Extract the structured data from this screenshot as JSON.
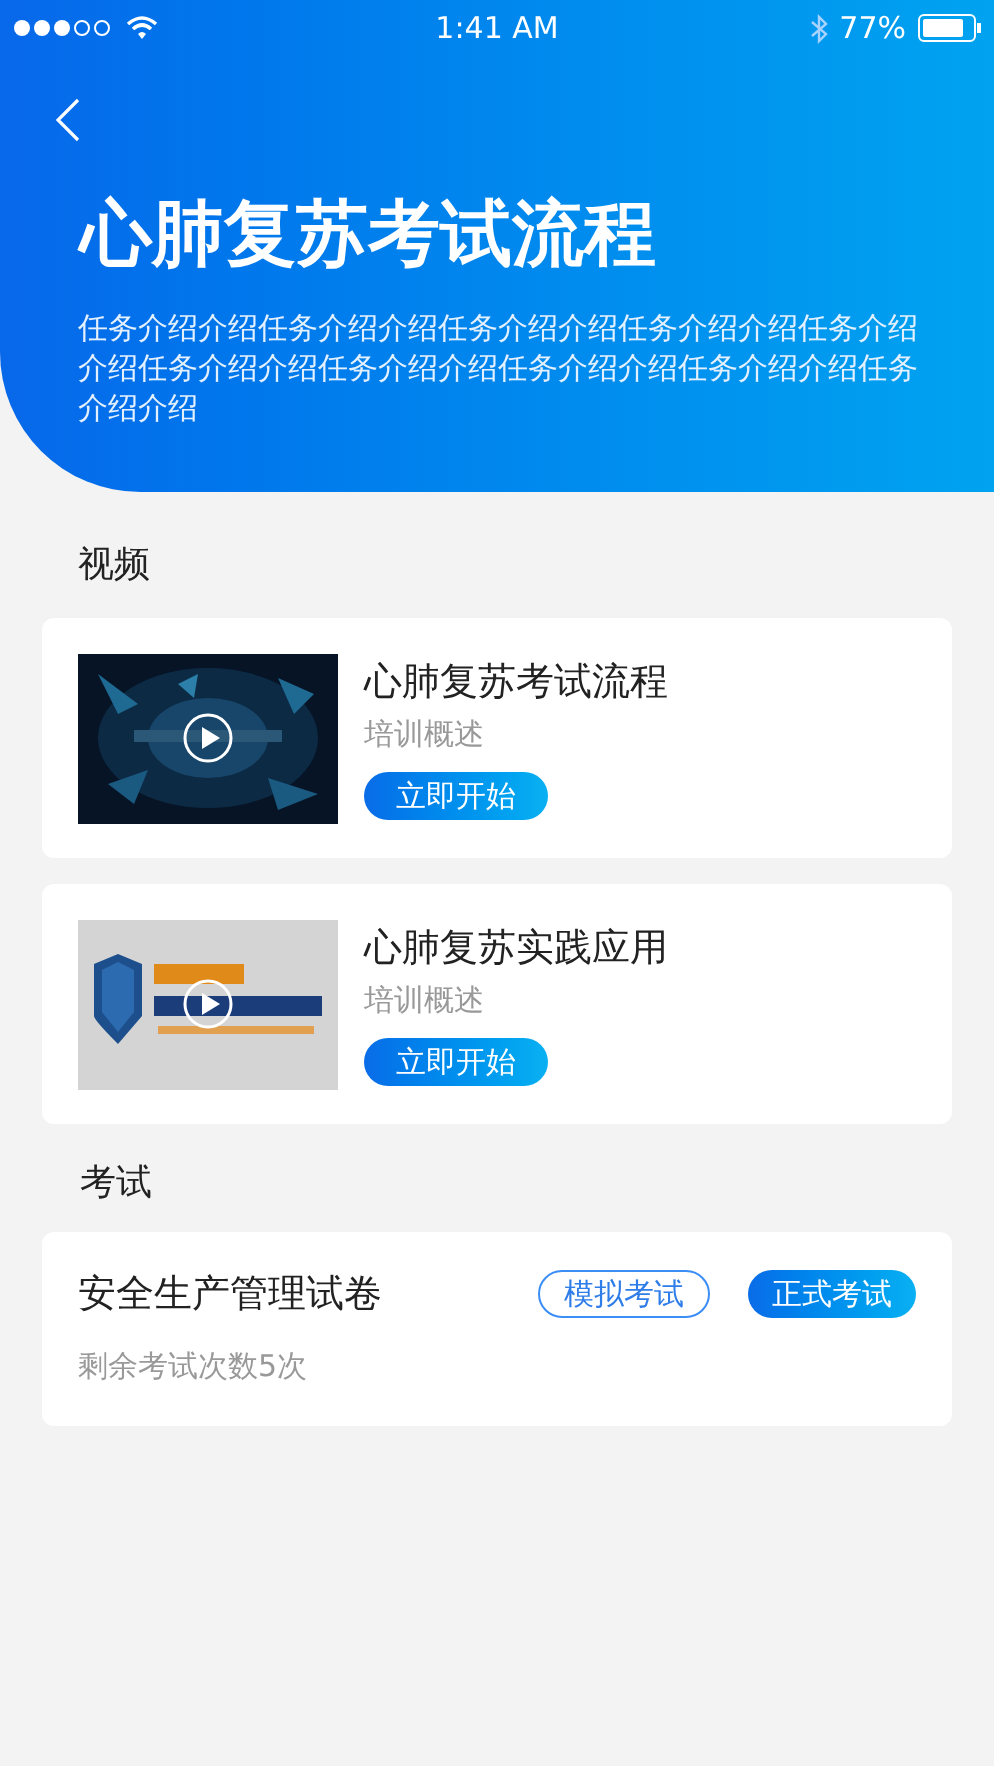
{
  "status_bar": {
    "time": "1:41 AM",
    "battery": "77%"
  },
  "header": {
    "title": "心肺复苏考试流程",
    "description": "任务介绍介绍任务介绍介绍任务介绍介绍任务介绍介绍任务介绍介绍任务介绍介绍任务介绍介绍任务介绍介绍任务介绍介绍任务介绍介绍"
  },
  "video_section": {
    "title": "视频",
    "items": [
      {
        "title": "心肺复苏考试流程",
        "subtitle": "培训概述",
        "button": "立即开始"
      },
      {
        "title": "心肺复苏实践应用",
        "subtitle": "培训概述",
        "button": "立即开始"
      }
    ]
  },
  "exam_section": {
    "title": "考试",
    "items": [
      {
        "title": "安全生产管理试卷",
        "remaining": "剩余考试次数5次",
        "buttons": [
          {
            "label": "模拟考试",
            "kind": "outline"
          },
          {
            "label": "正式考试",
            "kind": "filled"
          }
        ]
      }
    ]
  }
}
